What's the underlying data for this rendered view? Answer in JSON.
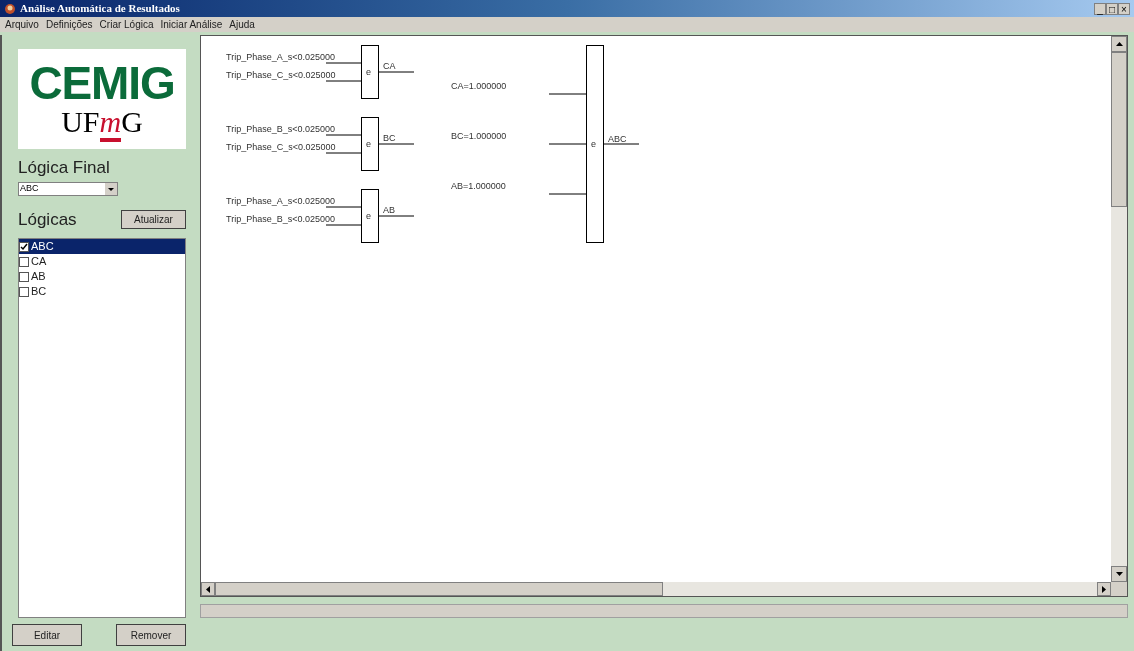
{
  "window": {
    "title": "Análise Automática de Resultados",
    "controls": [
      "_",
      "□",
      "×"
    ]
  },
  "menu": [
    "Arquivo",
    "Definições",
    "Criar Lógica",
    "Iniciar Análise",
    "Ajuda"
  ],
  "logo": {
    "top": "CEMIG",
    "bottom_left": "UF",
    "bottom_accent": "m",
    "bottom_right": "G"
  },
  "final_logic": {
    "label": "Lógica Final",
    "value": "ABC"
  },
  "logics": {
    "label": "Lógicas",
    "refresh_button": "Atualizar",
    "items": [
      {
        "name": "ABC",
        "checked": true,
        "selected": true
      },
      {
        "name": "CA",
        "checked": false,
        "selected": false
      },
      {
        "name": "AB",
        "checked": false,
        "selected": false
      },
      {
        "name": "BC",
        "checked": false,
        "selected": false
      }
    ]
  },
  "buttons": [
    "Editar",
    "Remover"
  ],
  "diagram": {
    "gates": [
      {
        "label": "e",
        "output": "CA",
        "inputs": [
          "Trip_Phase_A_s<0.025000",
          "Trip_Phase_C_s<0.025000"
        ]
      },
      {
        "label": "e",
        "output": "BC",
        "inputs": [
          "Trip_Phase_B_s<0.025000",
          "Trip_Phase_C_s<0.025000"
        ]
      },
      {
        "label": "e",
        "output": "AB",
        "inputs": [
          "Trip_Phase_A_s<0.025000",
          "Trip_Phase_B_s<0.025000"
        ]
      }
    ],
    "final_gate": {
      "label": "e",
      "output": "ABC",
      "inputs": [
        "CA=1.000000",
        "BC=1.000000",
        "AB=1.000000"
      ]
    }
  }
}
